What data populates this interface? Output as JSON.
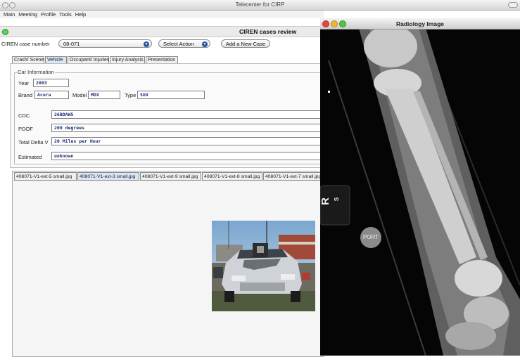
{
  "window": {
    "title": "Telecenter for CIRP"
  },
  "menu": [
    "Main",
    "Meeting",
    "Profile",
    "Tools",
    "Help"
  ],
  "header": {
    "title": "CIREN cases review"
  },
  "case_row": {
    "label": "CIREN case number",
    "case_number": "08-071",
    "select_action": "Select Action",
    "add_case": "Add a New Case"
  },
  "tabs": [
    "Crash/ Scene",
    "Vehicle",
    "Occupant/ Injuries",
    "Injury Analysis",
    "Presentation"
  ],
  "active_tab": "Vehicle",
  "car_info": {
    "legend": "Car Information",
    "year_label": "Year",
    "year": "2003",
    "brand_label": "Brand",
    "brand": "Acura",
    "model_label": "Model",
    "model": "MDX",
    "type_label": "Type",
    "type": "SUV",
    "cdc_label": "CDC",
    "cdc": "26BDAW5",
    "pdof_label": "PDOF",
    "pdof": "200 degrees",
    "delta_label": "Total Delta V",
    "delta": "20 Miles per Hour",
    "estimated_label": "Estimated",
    "estimated": "unknown"
  },
  "image_tabs": [
    "408071-V1-ext-5 small.jpg",
    "408071-V1-ext-3 small.jpg",
    "408071-V1-ext-9 small.jpg",
    "408071-V1-ext-8 small.jpg",
    "408071-V1-ext-7 small.jpg"
  ],
  "active_image_tab": "408071-V1-ext-3 small.jpg",
  "radiology": {
    "title": "Radiology Image",
    "marker_text": "R",
    "marker_small": "S",
    "port_label": "PORT"
  },
  "colors": {
    "green_dot": "#5ad55a",
    "rad_close": "#e8483a",
    "rad_min": "#f0b63a",
    "rad_max": "#58c147",
    "field_text": "#1a2a7a",
    "select_arrow": "#2456a8"
  }
}
